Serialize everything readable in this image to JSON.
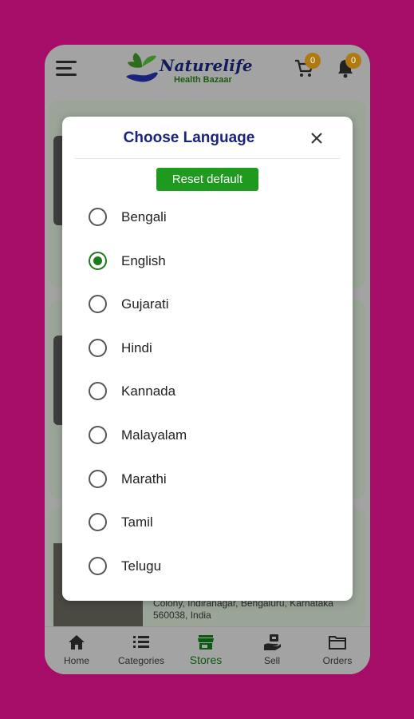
{
  "header": {
    "brand_name": "Naturelife",
    "brand_tagline": "Health Bazaar",
    "cart_count": "0",
    "notification_count": "0"
  },
  "background": {
    "address_text": "Colony, Indiranagar, Bengaluru, Karnataka 560038, India"
  },
  "dialog": {
    "title": "Choose Language",
    "reset_label": "Reset default",
    "selected": "English",
    "languages": [
      "Bengali",
      "English",
      "Gujarati",
      "Hindi",
      "Kannada",
      "Malayalam",
      "Marathi",
      "Tamil",
      "Telugu"
    ]
  },
  "tabbar": {
    "tabs": [
      {
        "label": "Home",
        "icon": "home-icon"
      },
      {
        "label": "Categories",
        "icon": "list-icon"
      },
      {
        "label": "Stores",
        "icon": "store-icon"
      },
      {
        "label": "Sell",
        "icon": "sell-icon"
      },
      {
        "label": "Orders",
        "icon": "folder-icon"
      }
    ],
    "active": "Stores"
  },
  "colors": {
    "page_background": "#a50d68",
    "title": "#1a237e",
    "accent_green": "#1e9a1e",
    "badge": "#b07a11"
  }
}
